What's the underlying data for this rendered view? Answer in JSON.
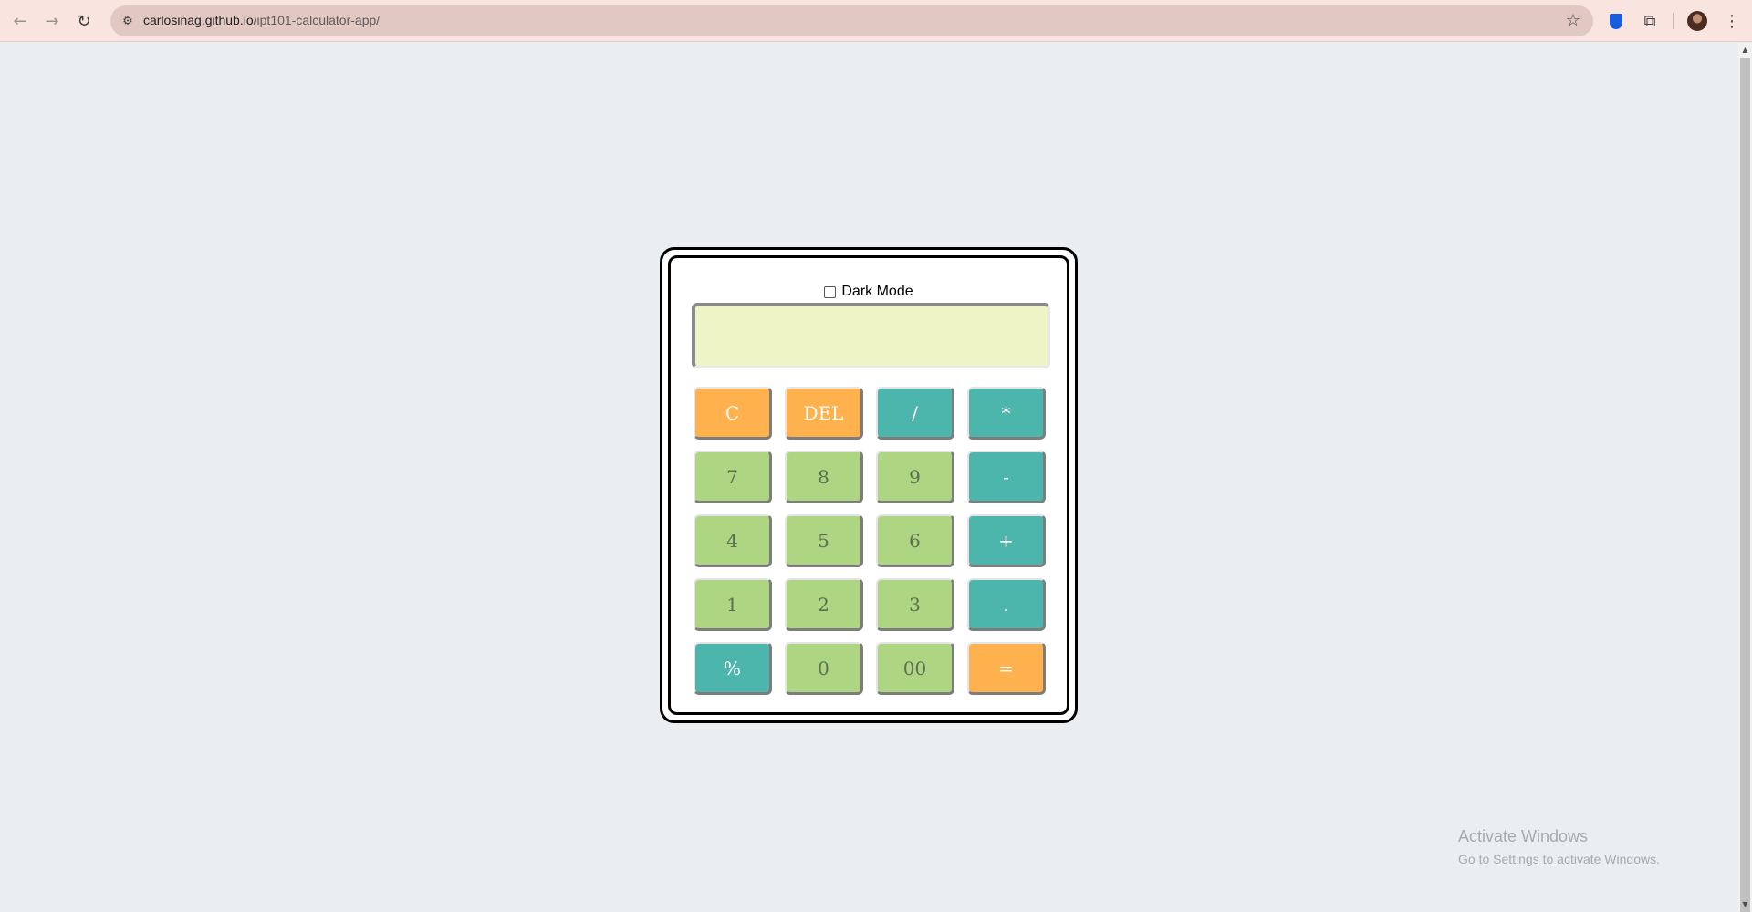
{
  "browser": {
    "back_icon": "←",
    "forward_icon": "→",
    "reload_icon": "↻",
    "site_info_icon": "⚙",
    "url_host": "carlosinag.github.io",
    "url_path": "/ipt101-calculator-app/",
    "star_icon": "☆",
    "bitwarden_icon": "⛨",
    "extensions_icon": "⧉",
    "menu_icon": "⋮"
  },
  "calculator": {
    "dark_mode_label": "Dark Mode",
    "dark_mode_checked": false,
    "display_value": "",
    "keys": [
      {
        "label": "C",
        "color": "#ffb14e",
        "kind": "orange"
      },
      {
        "label": "DEL",
        "color": "#ffb14e",
        "kind": "orange"
      },
      {
        "label": "/",
        "color": "#4db6ac",
        "kind": "teal"
      },
      {
        "label": "*",
        "color": "#4db6ac",
        "kind": "teal"
      },
      {
        "label": "7",
        "color": "#aed581",
        "kind": "green"
      },
      {
        "label": "8",
        "color": "#aed581",
        "kind": "green"
      },
      {
        "label": "9",
        "color": "#aed581",
        "kind": "green"
      },
      {
        "label": "-",
        "color": "#4db6ac",
        "kind": "teal"
      },
      {
        "label": "4",
        "color": "#aed581",
        "kind": "green"
      },
      {
        "label": "5",
        "color": "#aed581",
        "kind": "green"
      },
      {
        "label": "6",
        "color": "#aed581",
        "kind": "green"
      },
      {
        "label": "+",
        "color": "#4db6ac",
        "kind": "teal"
      },
      {
        "label": "1",
        "color": "#aed581",
        "kind": "green"
      },
      {
        "label": "2",
        "color": "#aed581",
        "kind": "green"
      },
      {
        "label": "3",
        "color": "#aed581",
        "kind": "green"
      },
      {
        "label": ".",
        "color": "#4db6ac",
        "kind": "teal"
      },
      {
        "label": "%",
        "color": "#4db6ac",
        "kind": "teal"
      },
      {
        "label": "0",
        "color": "#aed581",
        "kind": "green"
      },
      {
        "label": "00",
        "color": "#aed581",
        "kind": "green"
      },
      {
        "label": "=",
        "color": "#ffb14e",
        "kind": "orange"
      }
    ]
  },
  "watermark": {
    "title": "Activate Windows",
    "subtitle": "Go to Settings to activate Windows."
  },
  "colors": {
    "page_bg": "#eaeef1",
    "display_bg": "#eff4c6",
    "orange": "#ffb14e",
    "teal": "#4db6ac",
    "green": "#aed581"
  }
}
